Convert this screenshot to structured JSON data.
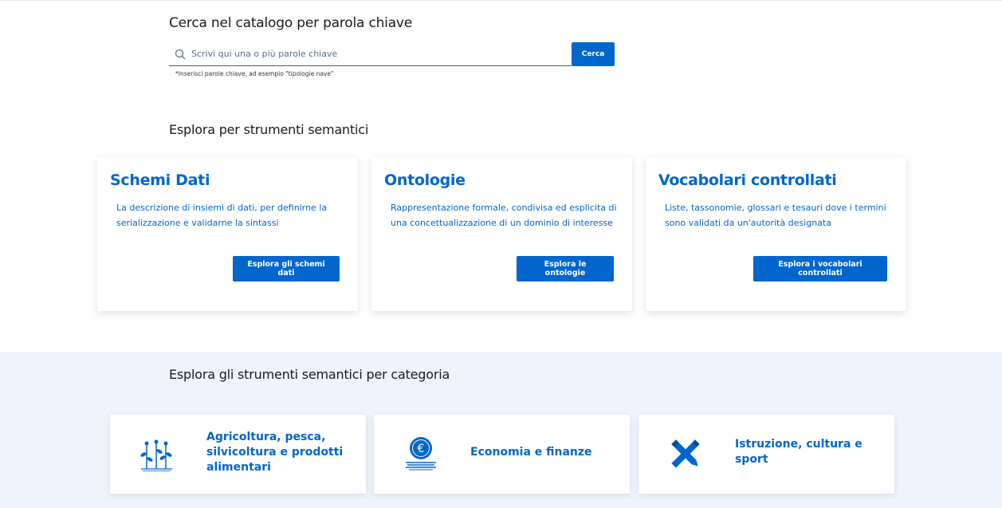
{
  "search": {
    "title": "Cerca nel catalogo per parola chiave",
    "placeholder": "Scrivi qui una o più parole chiave",
    "button_label": "Cerca",
    "hint": "*Inserisci parole chiave, ad esempio \"tipologie nave\""
  },
  "semantic": {
    "title": "Esplora per strumenti semantici",
    "cards": [
      {
        "title": "Schemi Dati",
        "description": "La descrizione di insiemi di dati, per definirne la serializzazione e validarne la sintassi",
        "button_label": "Esplora gli schemi dati"
      },
      {
        "title": "Ontologie",
        "description": "Rappresentazione formale, condivisa ed esplicita di una concettualizzazione di un dominio di interesse",
        "button_label": "Esplora le ontologie"
      },
      {
        "title": "Vocabolari controllati",
        "description": "Liste, tassonomie, glossari e tesauri dove i termini sono validati da un'autorità designata",
        "button_label": "Esplora i vocabolari controllati"
      }
    ]
  },
  "categories": {
    "title": "Esplora gli strumenti semantici per categoria",
    "items": [
      {
        "label": "Agricoltura, pesca, silvicoltura e prodotti alimentari",
        "icon": "agriculture-icon"
      },
      {
        "label": "Economia e finanze",
        "icon": "euro-coin-icon"
      },
      {
        "label": "Istruzione, cultura e sport",
        "icon": "pencil-cross-icon"
      }
    ]
  },
  "colors": {
    "primary": "#0066cc",
    "background_alt": "#eef4fc"
  }
}
